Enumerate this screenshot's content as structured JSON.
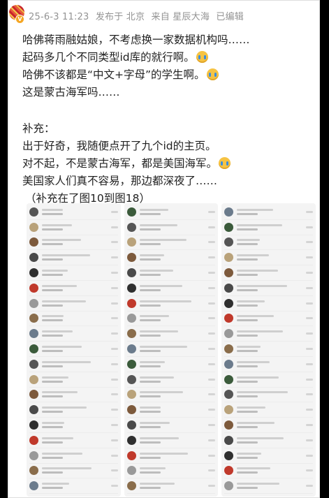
{
  "post": {
    "meta": {
      "datetime": "25-6-3 11:23",
      "location": "发布于 北京",
      "source": "来自 星辰大海",
      "edited": "已编辑"
    },
    "badge": "V",
    "lines": [
      "哈佛蒋雨融姑娘，不考虑换一家数据机构吗……",
      "起码多几个不同类型id库的就行啊。",
      "哈佛不该都是“中文+字母”的学生啊。",
      "这是蒙古海军吗……"
    ],
    "supplement": [
      "补充：",
      "出于好奇，我随便点开了九个id的主页。",
      "对不起，不是蒙古海军，都是美国海军。",
      "美国家人们真不容易，那边都深夜了……",
      "（补充在了图10到图18）"
    ],
    "emoji_icon": "crying-face-icon"
  }
}
